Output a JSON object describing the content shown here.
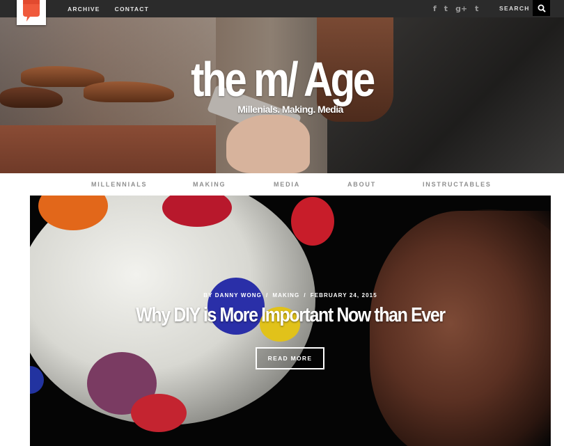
{
  "topbar": {
    "nav": [
      "ARCHIVE",
      "CONTACT"
    ],
    "social_icons": [
      "facebook-icon",
      "twitter-icon",
      "google-plus-icon",
      "tumblr-icon"
    ],
    "social_glyphs": [
      "f",
      "t",
      "g+",
      "t"
    ],
    "search_label": "SEARCH",
    "search_icon": "search-icon"
  },
  "hero": {
    "title": "the m/ Age",
    "tagline": "Millenials. Making. Media"
  },
  "category_nav": [
    "MILLENNIALS",
    "MAKING",
    "MEDIA",
    "ABOUT",
    "INSTRUCTABLES"
  ],
  "featured_post": {
    "author": "BY DANNY WONG",
    "separator": "/",
    "category": "MAKING",
    "date_prefix": "/",
    "date": "FEBRUARY 24, 2015",
    "title": "Why DIY is More Important Now than Ever",
    "read_more": "READ MORE"
  },
  "colors": {
    "topbar": "#2b2b2b",
    "logo_accent": "#f05a3c",
    "nav_text": "#8e8e8e",
    "search_button": "#000000"
  }
}
